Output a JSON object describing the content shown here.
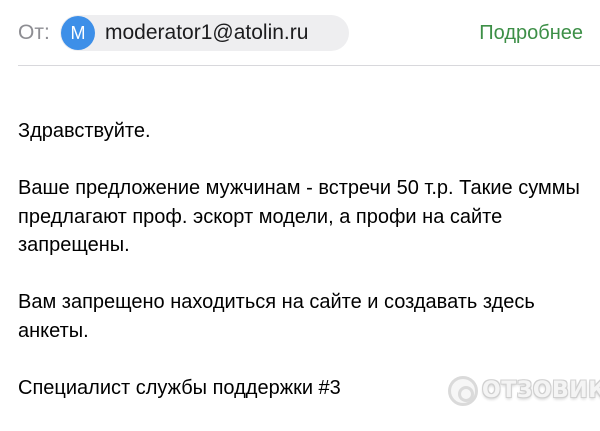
{
  "header": {
    "from_label": "От:",
    "sender": {
      "avatar_letter": "M",
      "email": "moderator1@atolin.ru"
    },
    "details_link": "Подробнее"
  },
  "message": {
    "greeting": "Здравствуйте.",
    "paragraph_1": "Ваше предложение мужчинам - встречи 50 т.р. Такие суммы предлагают проф. эскорт модели, а профи на сайте запрещены.",
    "paragraph_2": "Вам запрещено находиться на сайте и создавать здесь анкеты.",
    "signature": "Специалист службы поддержки #3"
  },
  "watermark": {
    "text": "ОТЗОВИК"
  },
  "colors": {
    "avatar": "#3d8fe8",
    "link": "#3d8f47",
    "chip": "#eeeef0",
    "muted": "#8e8e93"
  }
}
